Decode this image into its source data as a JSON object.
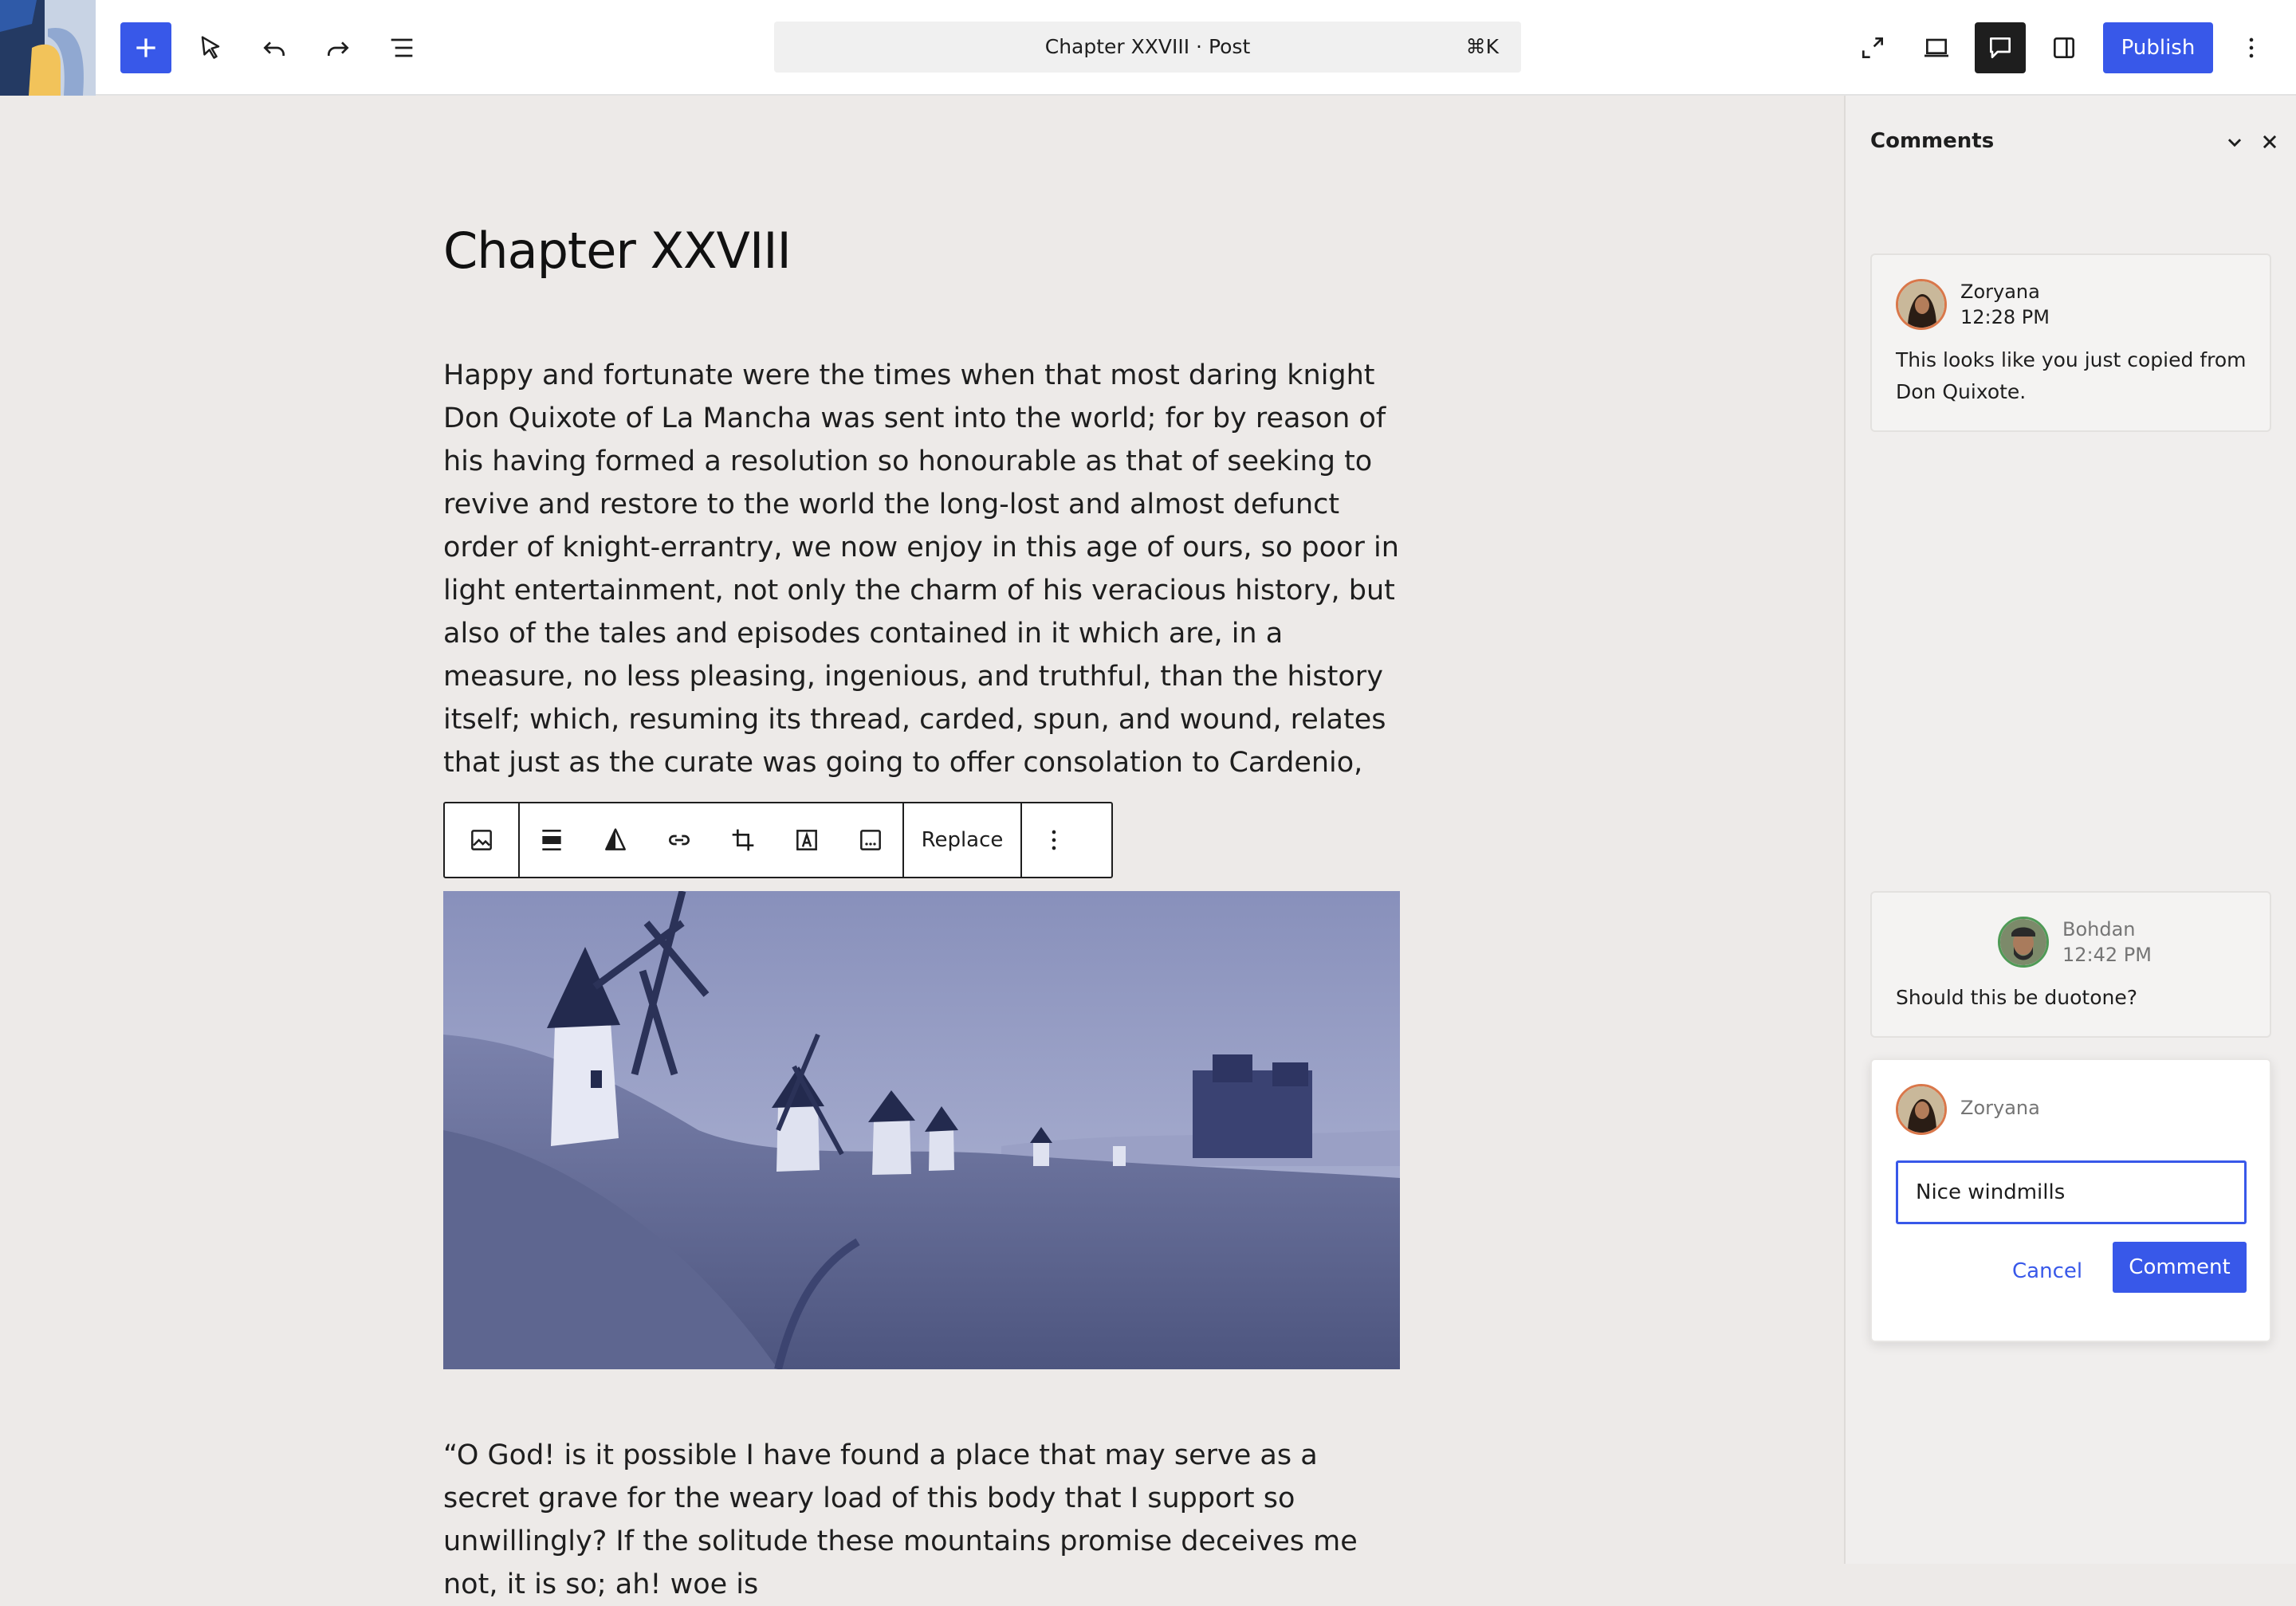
{
  "topbar": {
    "command_title": "Chapter XXVIII · Post",
    "command_shortcut": "⌘K",
    "publish_label": "Publish"
  },
  "post": {
    "title": "Chapter XXVIII",
    "paragraph_1": "Happy and fortunate were the times when that most daring knight Don Quixote of La Mancha was sent into the world; for by reason of his having formed a resolution so honourable as that of seeking to revive and restore to the world the long-lost and almost defunct order of knight-errantry, we now enjoy in this age of ours, so poor in light entertainment, not only the charm of his veracious history, but also of the tales and episodes contained in it which are, in a measure, no less pleasing, ingenious, and truthful, than the history itself; which, resuming its thread, carded, spun, and wound, relates that just as the curate was going to offer consolation to Cardenio, he was interrupted by a voice that fell on his ears saying in plaintive tones",
    "paragraph_2": "“O God! is it possible I have found a place that may serve as a secret grave for the weary load of this body that I support so unwillingly? If the solitude these mountains promise deceives me not, it is so; ah! woe is"
  },
  "block_toolbar": {
    "replace_label": "Replace"
  },
  "sidebar": {
    "title": "Comments",
    "comments": [
      {
        "author": "Zoryana",
        "time": "12:28 PM",
        "text": "This looks like you just copied from Don Quixote."
      },
      {
        "author": "Bohdan",
        "time": "12:42 PM",
        "text": "Should this be duotone?"
      }
    ],
    "reply": {
      "author": "Zoryana",
      "value": "Nice windmills",
      "cancel_label": "Cancel",
      "submit_label": "Comment"
    }
  },
  "colors": {
    "accent": "#3858e9",
    "canvas": "#edeae8",
    "highlight": "#d6d4e4",
    "duotone_dark": "#232a4e",
    "duotone_light": "#e6e8f4"
  },
  "icons": [
    "plus-icon",
    "select-tool-icon",
    "undo-icon",
    "redo-icon",
    "document-overview-icon",
    "fullscreen-icon",
    "desktop-preview-icon",
    "comment-icon",
    "sidebar-toggle-icon",
    "more-vertical-icon",
    "image-icon",
    "align-icon",
    "duotone-icon",
    "link-icon",
    "crop-icon",
    "text-over-image-icon",
    "caption-icon",
    "chevron-down-icon",
    "close-icon"
  ]
}
